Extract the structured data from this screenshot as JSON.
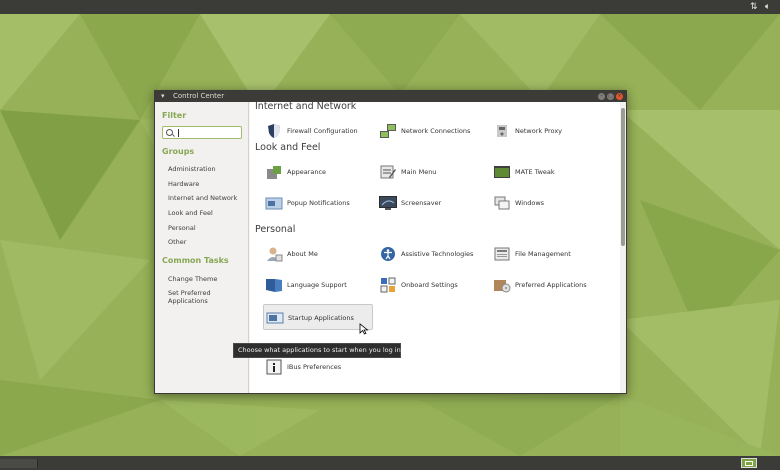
{
  "window": {
    "title": "Control Center",
    "menu_icon": "window-menu-icon"
  },
  "sidebar": {
    "filter_heading": "Filter",
    "filter_value": "",
    "groups_heading": "Groups",
    "groups": [
      "Administration",
      "Hardware",
      "Internet and Network",
      "Look and Feel",
      "Personal",
      "Other"
    ],
    "tasks_heading": "Common Tasks",
    "tasks": [
      "Change Theme",
      "Set Preferred",
      "Applications"
    ]
  },
  "sections": [
    {
      "title": "Internet and Network",
      "items": [
        {
          "label": "Firewall Configuration",
          "icon": "firewall-shield-icon"
        },
        {
          "label": "Network Connections",
          "icon": "network-connections-icon"
        },
        {
          "label": "Network Proxy",
          "icon": "network-proxy-icon"
        }
      ]
    },
    {
      "title": "Look and Feel",
      "items": [
        {
          "label": "Appearance",
          "icon": "appearance-icon"
        },
        {
          "label": "Main Menu",
          "icon": "main-menu-icon"
        },
        {
          "label": "MATE Tweak",
          "icon": "mate-tweak-icon"
        },
        {
          "label": "Popup Notifications",
          "icon": "popup-notifications-icon"
        },
        {
          "label": "Screensaver",
          "icon": "screensaver-icon"
        },
        {
          "label": "Windows",
          "icon": "windows-icon"
        }
      ]
    },
    {
      "title": "Personal",
      "items": [
        {
          "label": "About Me",
          "icon": "about-me-icon"
        },
        {
          "label": "Assistive Technologies",
          "icon": "accessibility-icon"
        },
        {
          "label": "File Management",
          "icon": "file-management-icon"
        },
        {
          "label": "Language Support",
          "icon": "language-support-icon"
        },
        {
          "label": "Onboard Settings",
          "icon": "onboard-keyboard-icon"
        },
        {
          "label": "Preferred Applications",
          "icon": "preferred-applications-icon"
        },
        {
          "label": "Startup Applications",
          "icon": "startup-applications-icon"
        },
        {
          "label": "IBus Preferences",
          "icon": "info-icon"
        }
      ]
    }
  ],
  "tooltip": "Choose what applications to start when you log in",
  "colors": {
    "accent": "#87a752",
    "panel": "#3b3b38",
    "close_button": "#e4572e"
  }
}
